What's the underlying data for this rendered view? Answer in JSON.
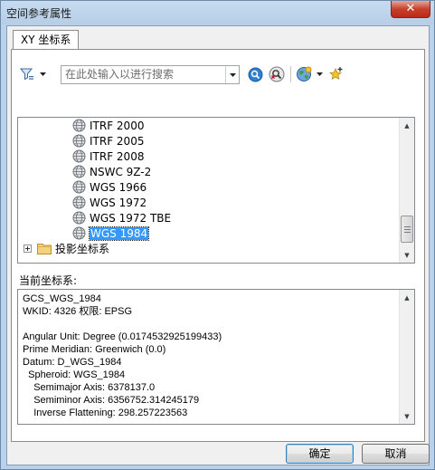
{
  "window": {
    "title": "空间参考属性",
    "close_glyph": "✕"
  },
  "tabs": [
    {
      "label": "XY 坐标系"
    }
  ],
  "toolbar": {
    "search_placeholder": "在此处输入以进行搜索",
    "icons": [
      "filter-icon",
      "chevron-down-icon",
      "search-icon",
      "clear-search-icon",
      "globe-add-icon",
      "chevron-down-icon",
      "favorite-add-icon"
    ]
  },
  "tree": {
    "items": [
      {
        "label": "ITRF 2000"
      },
      {
        "label": "ITRF 2005"
      },
      {
        "label": "ITRF 2008"
      },
      {
        "label": "NSWC 9Z-2"
      },
      {
        "label": "WGS 1966"
      },
      {
        "label": "WGS 1972"
      },
      {
        "label": "WGS 1972 TBE"
      },
      {
        "label": "WGS 1984",
        "selected": true
      }
    ],
    "folder": {
      "label": "投影坐标系"
    }
  },
  "current": {
    "label": "当前坐标系:",
    "details": "GCS_WGS_1984\nWKID: 4326 权限: EPSG\n\nAngular Unit: Degree (0.0174532925199433)\nPrime Meridian: Greenwich (0.0)\nDatum: D_WGS_1984\n  Spheroid: WGS_1984\n    Semimajor Axis: 6378137.0\n    Semiminor Axis: 6356752.314245179\n    Inverse Flattening: 298.257223563"
  },
  "buttons": {
    "ok": "确定",
    "cancel": "取消"
  },
  "colors": {
    "selection": "#3399ff",
    "title_bar": "#b9d1ea",
    "close_button": "#c7402c"
  }
}
